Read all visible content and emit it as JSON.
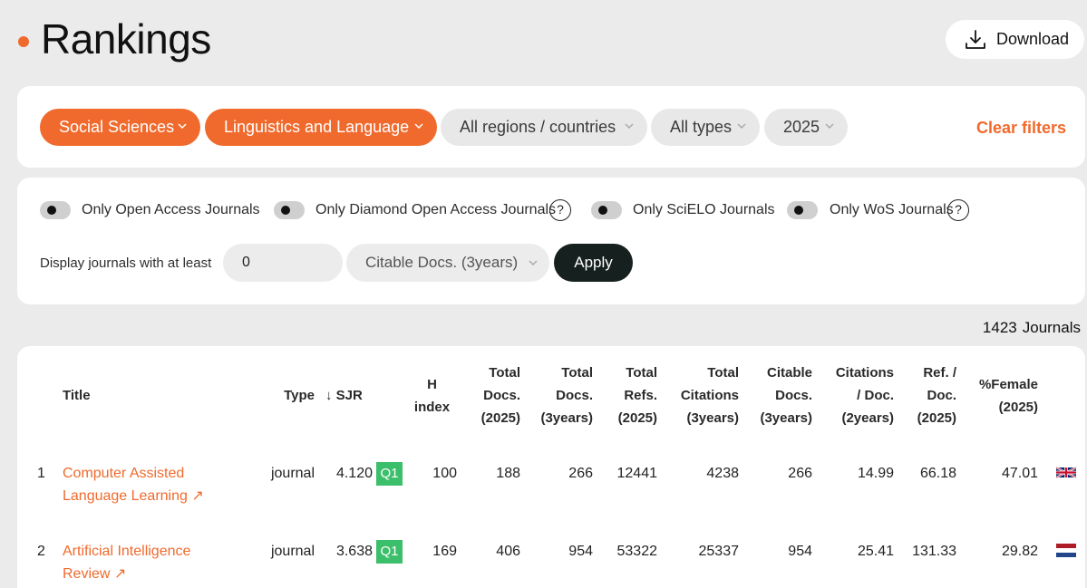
{
  "header": {
    "title": "Rankings",
    "download_label": "Download"
  },
  "filters": {
    "area": "Social Sciences",
    "category": "Linguistics and Language",
    "region": "All regions / countries",
    "type": "All types",
    "year": "2025",
    "clear_label": "Clear filters"
  },
  "toggles": [
    {
      "label": "Only Open Access Journals"
    },
    {
      "label": "Only Diamond Open Access Journals"
    },
    {
      "label": "Only SciELO Journals"
    },
    {
      "label": "Only WoS Journals"
    }
  ],
  "help_glyph": "?",
  "threshold": {
    "label": "Display journals with at least",
    "value": "0",
    "metric": "Citable Docs. (3years)",
    "apply_label": "Apply"
  },
  "result_count": {
    "number": "1423",
    "unit": "Journals"
  },
  "table": {
    "headers": {
      "title": "Title",
      "type": "Type",
      "sjr": "↓ SJR",
      "h_index": [
        "H",
        "index"
      ],
      "total_docs_year": [
        "Total",
        "Docs.",
        "(2025)"
      ],
      "total_docs_3y": [
        "Total",
        "Docs.",
        "(3years)"
      ],
      "total_refs": [
        "Total",
        "Refs.",
        "(2025)"
      ],
      "total_citations": [
        "Total",
        "Citations",
        "(3years)"
      ],
      "citable_docs": [
        "Citable",
        "Docs.",
        "(3years)"
      ],
      "citations_per_doc": [
        "Citations",
        "/ Doc.",
        "(2years)"
      ],
      "ref_per_doc": [
        "Ref. /",
        "Doc.",
        "(2025)"
      ],
      "female": [
        "%Female",
        "(2025)"
      ]
    },
    "rows": [
      {
        "rank": "1",
        "title_lines": [
          "Computer Assisted",
          "Language Learning ↗"
        ],
        "type": "journal",
        "sjr": "4.120",
        "quartile": "Q1",
        "h_index": "100",
        "total_docs_year": "188",
        "total_docs_3y": "266",
        "total_refs": "12441",
        "total_citations": "4238",
        "citable_docs": "266",
        "citations_per_doc": "14.99",
        "ref_per_doc": "66.18",
        "female": "47.01",
        "flag": "uk-flag"
      },
      {
        "rank": "2",
        "title_lines": [
          "Artificial Intelligence",
          "Review ↗"
        ],
        "type": "journal",
        "sjr": "3.638",
        "quartile": "Q1",
        "h_index": "169",
        "total_docs_year": "406",
        "total_docs_3y": "954",
        "total_refs": "53322",
        "total_citations": "25337",
        "citable_docs": "954",
        "citations_per_doc": "25.41",
        "ref_per_doc": "131.33",
        "female": "29.82",
        "flag": "netherlands-flag"
      }
    ]
  },
  "colors": {
    "accent": "#f06a2d",
    "quartile_q1": "#3cbf6a",
    "apply_bg": "#16201f",
    "page_bg": "#ebebeb"
  }
}
